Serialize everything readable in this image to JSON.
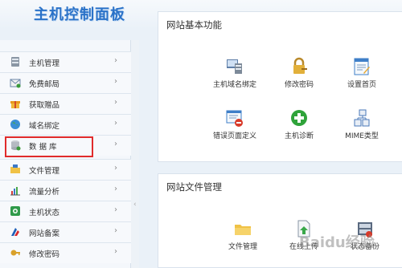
{
  "header": {
    "title": "主机控制面板"
  },
  "sidebar": {
    "items": [
      {
        "label": "主机管理",
        "icon": "server-icon"
      },
      {
        "label": "免费邮局",
        "icon": "mail-icon"
      },
      {
        "label": "获取赠品",
        "icon": "gift-icon"
      },
      {
        "label": "域名绑定",
        "icon": "globe-icon"
      },
      {
        "label": "数 据 库",
        "icon": "database-icon"
      },
      {
        "label": "文件管理",
        "icon": "folder-icon"
      },
      {
        "label": "流量分析",
        "icon": "chart-icon"
      },
      {
        "label": "主机状态",
        "icon": "status-icon"
      },
      {
        "label": "网站备案",
        "icon": "flag-icon"
      },
      {
        "label": "修改密码",
        "icon": "key-icon"
      }
    ],
    "chevron": "›"
  },
  "panel_basic": {
    "title": "网站基本功能",
    "functions": [
      {
        "label": "主机域名绑定",
        "icon": "domain-bind-icon"
      },
      {
        "label": "修改密码",
        "icon": "lock-icon"
      },
      {
        "label": "设置首页",
        "icon": "homepage-icon"
      },
      {
        "label": "错误页面定义",
        "icon": "error-page-icon"
      },
      {
        "label": "主机诊断",
        "icon": "diagnose-icon"
      },
      {
        "label": "MIME类型",
        "icon": "mime-icon"
      }
    ]
  },
  "panel_files": {
    "title": "网站文件管理",
    "functions": [
      {
        "label": "文件管理",
        "icon": "file-folder-icon"
      },
      {
        "label": "在线上传",
        "icon": "upload-icon"
      },
      {
        "label": "状态备份",
        "icon": "backup-icon"
      }
    ]
  },
  "watermark": "Baidu经验",
  "colors": {
    "highlight": "#e02b2b",
    "title_blue": "#2a72c8"
  }
}
